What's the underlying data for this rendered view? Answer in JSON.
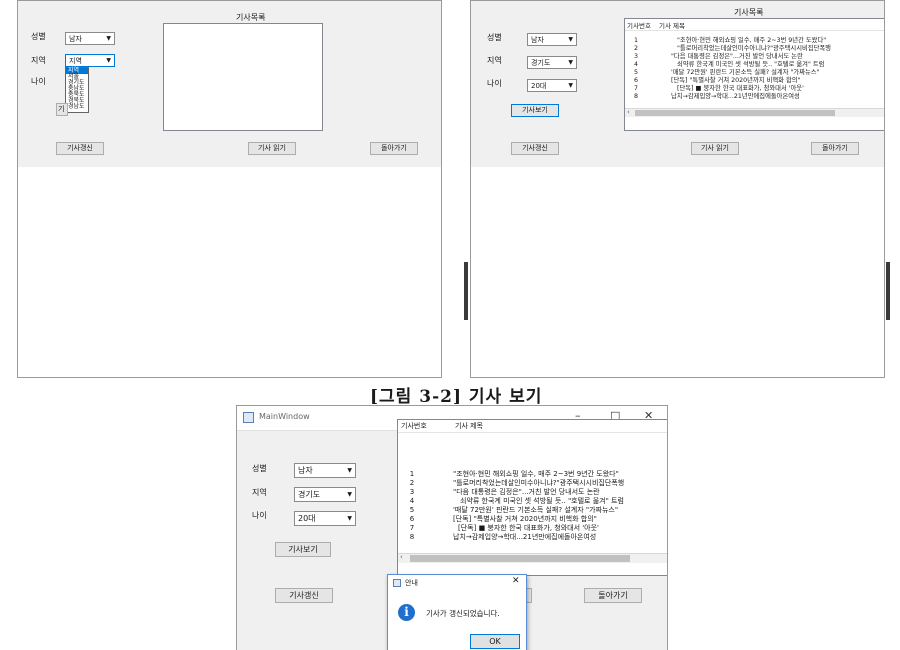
{
  "caption": "[그림 3-2] 기사 보기",
  "form": {
    "list_title": "기사목록",
    "gender_label": "성별",
    "region_label": "지역",
    "age_label": "나이",
    "col_no": "기사번호",
    "col_title": "기사 제목",
    "update_button": "기사갱신",
    "read_button": "기사 읽기",
    "back_button": "돌아가기",
    "view_button": "기사보기",
    "view_button_partial": "기사"
  },
  "screen1": {
    "gender_value": "남자",
    "region_value": "지역",
    "region_options": [
      "지역",
      "서울",
      "경기도",
      "충남도",
      "충북도",
      "경북도",
      "경남도"
    ]
  },
  "screen2": {
    "gender_value": "남자",
    "region_value": "경기도",
    "age_value": "20대"
  },
  "screen3": {
    "window_title": "MainWindow",
    "gender_value": "남자",
    "region_value": "경기도",
    "age_value": "20대",
    "dialog_title": "안내",
    "dialog_message": "기사가 갱신되었습니다.",
    "ok_button": "OK",
    "back_partial": "기"
  },
  "articles": [
    {
      "no": "1",
      "title": "\"조현아·현민 해외쇼핑 일수, 매주 2~3번 9년간 도왔다\""
    },
    {
      "no": "2",
      "title": "\"틀로머리착었는데살인미수아니냐?\"광주택시시비집단폭행"
    },
    {
      "no": "3",
      "title": "\"다음 대통령은 김정은\"...거친 발언 당내서도 논란"
    },
    {
      "no": "4",
      "title": "쇠약류 한국계 미국인 셋 석방될 듯.. \"호텔로 옮겨\" 트럼"
    },
    {
      "no": "5",
      "title": "'매달 72만원' 핀란드 기본소득 실패? 설계자 \"가짜뉴스\""
    },
    {
      "no": "6",
      "title": "[단독] \"특별사찰 거쳐 2020년까지 비핵화 합의\""
    },
    {
      "no": "7",
      "title": "[단독] ■ 붕자한 한국 대표화가, 청와대서 '아웃'"
    },
    {
      "no": "8",
      "title": "납치→감제입양→학대...21년만에집에돌아온여성"
    }
  ],
  "icons": {
    "dropdown": "chevron-down-icon",
    "info": "info-icon",
    "close": "close-icon",
    "minimize": "minimize-icon",
    "maximize": "maximize-icon",
    "app": "window-icon"
  },
  "colors": {
    "selection": "#0078d7",
    "info_icon": "#1f6fd0"
  }
}
